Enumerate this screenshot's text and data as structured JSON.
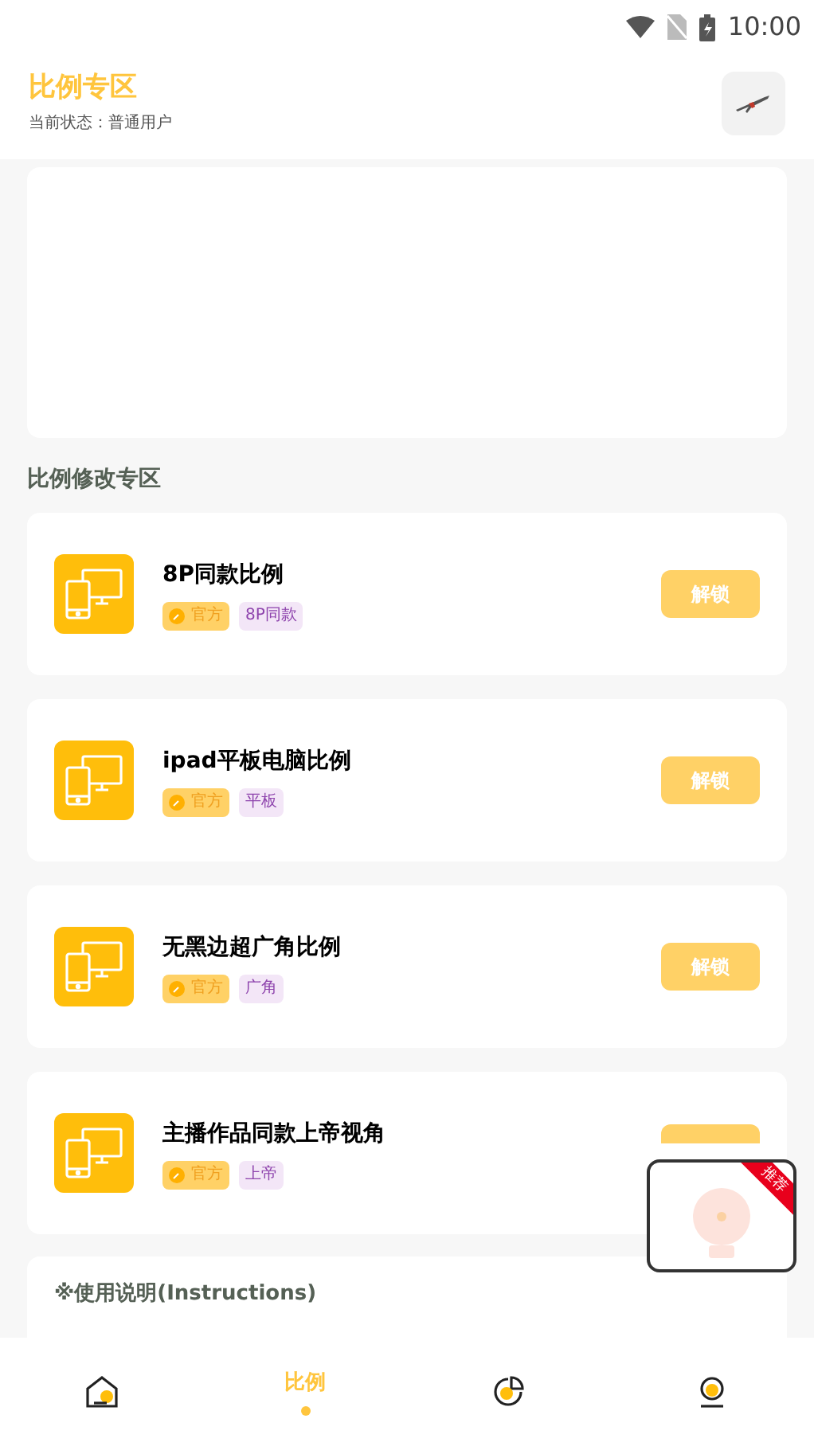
{
  "status_bar": {
    "time": "10:00"
  },
  "header": {
    "title": "比例专区",
    "subtitle": "当前状态：普通用户"
  },
  "section_title": "比例修改专区",
  "items": [
    {
      "title": "8P同款比例",
      "official": "官方",
      "tag": "8P同款",
      "button": "解锁"
    },
    {
      "title": "ipad平板电脑比例",
      "official": "官方",
      "tag": "平板",
      "button": "解锁"
    },
    {
      "title": "无黑边超广角比例",
      "official": "官方",
      "tag": "广角",
      "button": "解锁"
    },
    {
      "title": "主播作品同款上帝视角",
      "official": "官方",
      "tag": "上帝"
    }
  ],
  "floating_ad": {
    "ribbon": "推荐"
  },
  "instructions": {
    "title": "※使用说明(Instructions)"
  },
  "bottom_nav": [
    {
      "kind": "home",
      "selected": false
    },
    {
      "kind": "text",
      "label": "比例",
      "selected": true
    },
    {
      "kind": "chart",
      "selected": false
    },
    {
      "kind": "profile",
      "selected": false
    }
  ]
}
